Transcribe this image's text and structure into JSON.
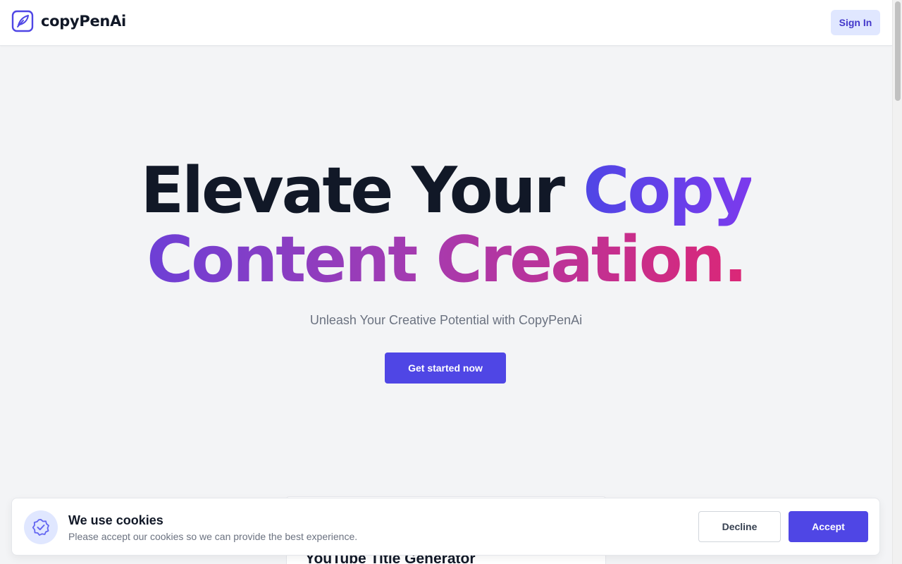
{
  "header": {
    "brand": "copyPenAi",
    "sign_in": "Sign In"
  },
  "hero": {
    "line1_plain": "Elevate Your",
    "line1_accent": "Copy",
    "line2_accent": "Content Creation.",
    "subtitle": "Unleash Your Creative Potential with CopyPenAi",
    "cta": "Get started now"
  },
  "card": {
    "title": "YouTube Title Generator"
  },
  "cookie": {
    "title": "We use cookies",
    "text": "Please accept our cookies so we can provide the best experience.",
    "decline": "Decline",
    "accept": "Accept",
    "icon": "badge-check-icon"
  },
  "colors": {
    "brand": "#4f46e5",
    "accent_pink": "#db2777",
    "background": "#f3f4f6"
  }
}
